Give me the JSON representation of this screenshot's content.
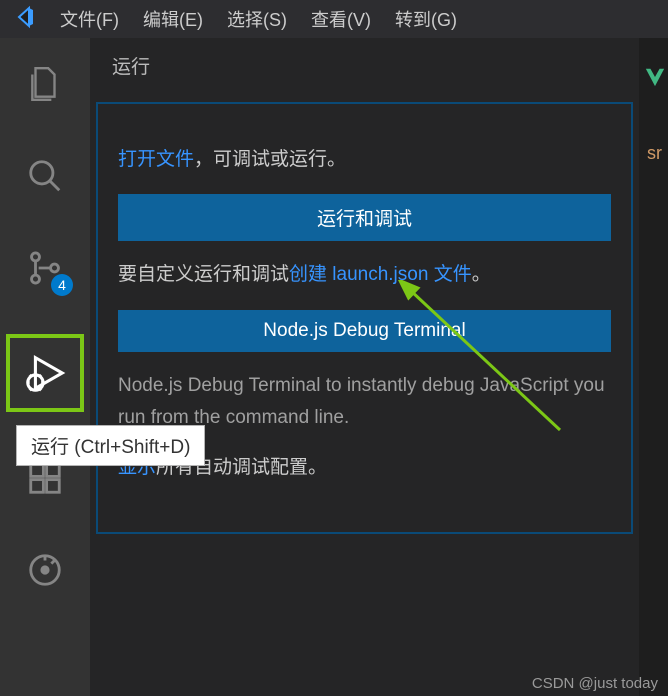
{
  "menu": {
    "file": "文件(F)",
    "edit": "编辑(E)",
    "select": "选择(S)",
    "view": "查看(V)",
    "go": "转到(G)"
  },
  "activitybar": {
    "badge_count": "4",
    "tooltip": "运行 (Ctrl+Shift+D)"
  },
  "sidebar": {
    "title": "运行",
    "open_file_link": "打开文件",
    "open_file_suffix": "，可调试或运行。",
    "run_debug_btn": "运行和调试",
    "customize_prefix": "要自定义运行和调试",
    "create_link": "创建 launch.json 文件",
    "customize_suffix": "。",
    "node_terminal_btn": "Node.js Debug Terminal",
    "node_desc_prefix": " Node.js Debug Terminal to instantly debug JavaScript you run from the command line.",
    "show_link": "显示",
    "show_suffix": "所有自动调试配置。"
  },
  "rightstrip": {
    "text1": "sr"
  },
  "watermark": "CSDN @just today"
}
